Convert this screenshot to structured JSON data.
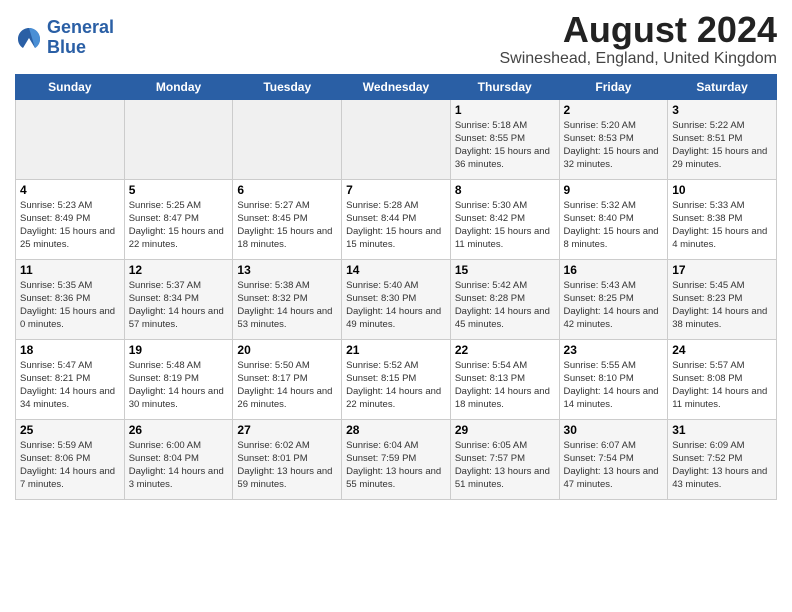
{
  "logo": {
    "name": "General",
    "name2": "Blue"
  },
  "title": "August 2024",
  "subtitle": "Swineshead, England, United Kingdom",
  "days_of_week": [
    "Sunday",
    "Monday",
    "Tuesday",
    "Wednesday",
    "Thursday",
    "Friday",
    "Saturday"
  ],
  "weeks": [
    [
      {
        "day": "",
        "sunrise": "",
        "sunset": "",
        "daylight": ""
      },
      {
        "day": "",
        "sunrise": "",
        "sunset": "",
        "daylight": ""
      },
      {
        "day": "",
        "sunrise": "",
        "sunset": "",
        "daylight": ""
      },
      {
        "day": "",
        "sunrise": "",
        "sunset": "",
        "daylight": ""
      },
      {
        "day": "1",
        "sunrise": "Sunrise: 5:18 AM",
        "sunset": "Sunset: 8:55 PM",
        "daylight": "Daylight: 15 hours and 36 minutes."
      },
      {
        "day": "2",
        "sunrise": "Sunrise: 5:20 AM",
        "sunset": "Sunset: 8:53 PM",
        "daylight": "Daylight: 15 hours and 32 minutes."
      },
      {
        "day": "3",
        "sunrise": "Sunrise: 5:22 AM",
        "sunset": "Sunset: 8:51 PM",
        "daylight": "Daylight: 15 hours and 29 minutes."
      }
    ],
    [
      {
        "day": "4",
        "sunrise": "Sunrise: 5:23 AM",
        "sunset": "Sunset: 8:49 PM",
        "daylight": "Daylight: 15 hours and 25 minutes."
      },
      {
        "day": "5",
        "sunrise": "Sunrise: 5:25 AM",
        "sunset": "Sunset: 8:47 PM",
        "daylight": "Daylight: 15 hours and 22 minutes."
      },
      {
        "day": "6",
        "sunrise": "Sunrise: 5:27 AM",
        "sunset": "Sunset: 8:45 PM",
        "daylight": "Daylight: 15 hours and 18 minutes."
      },
      {
        "day": "7",
        "sunrise": "Sunrise: 5:28 AM",
        "sunset": "Sunset: 8:44 PM",
        "daylight": "Daylight: 15 hours and 15 minutes."
      },
      {
        "day": "8",
        "sunrise": "Sunrise: 5:30 AM",
        "sunset": "Sunset: 8:42 PM",
        "daylight": "Daylight: 15 hours and 11 minutes."
      },
      {
        "day": "9",
        "sunrise": "Sunrise: 5:32 AM",
        "sunset": "Sunset: 8:40 PM",
        "daylight": "Daylight: 15 hours and 8 minutes."
      },
      {
        "day": "10",
        "sunrise": "Sunrise: 5:33 AM",
        "sunset": "Sunset: 8:38 PM",
        "daylight": "Daylight: 15 hours and 4 minutes."
      }
    ],
    [
      {
        "day": "11",
        "sunrise": "Sunrise: 5:35 AM",
        "sunset": "Sunset: 8:36 PM",
        "daylight": "Daylight: 15 hours and 0 minutes."
      },
      {
        "day": "12",
        "sunrise": "Sunrise: 5:37 AM",
        "sunset": "Sunset: 8:34 PM",
        "daylight": "Daylight: 14 hours and 57 minutes."
      },
      {
        "day": "13",
        "sunrise": "Sunrise: 5:38 AM",
        "sunset": "Sunset: 8:32 PM",
        "daylight": "Daylight: 14 hours and 53 minutes."
      },
      {
        "day": "14",
        "sunrise": "Sunrise: 5:40 AM",
        "sunset": "Sunset: 8:30 PM",
        "daylight": "Daylight: 14 hours and 49 minutes."
      },
      {
        "day": "15",
        "sunrise": "Sunrise: 5:42 AM",
        "sunset": "Sunset: 8:28 PM",
        "daylight": "Daylight: 14 hours and 45 minutes."
      },
      {
        "day": "16",
        "sunrise": "Sunrise: 5:43 AM",
        "sunset": "Sunset: 8:25 PM",
        "daylight": "Daylight: 14 hours and 42 minutes."
      },
      {
        "day": "17",
        "sunrise": "Sunrise: 5:45 AM",
        "sunset": "Sunset: 8:23 PM",
        "daylight": "Daylight: 14 hours and 38 minutes."
      }
    ],
    [
      {
        "day": "18",
        "sunrise": "Sunrise: 5:47 AM",
        "sunset": "Sunset: 8:21 PM",
        "daylight": "Daylight: 14 hours and 34 minutes."
      },
      {
        "day": "19",
        "sunrise": "Sunrise: 5:48 AM",
        "sunset": "Sunset: 8:19 PM",
        "daylight": "Daylight: 14 hours and 30 minutes."
      },
      {
        "day": "20",
        "sunrise": "Sunrise: 5:50 AM",
        "sunset": "Sunset: 8:17 PM",
        "daylight": "Daylight: 14 hours and 26 minutes."
      },
      {
        "day": "21",
        "sunrise": "Sunrise: 5:52 AM",
        "sunset": "Sunset: 8:15 PM",
        "daylight": "Daylight: 14 hours and 22 minutes."
      },
      {
        "day": "22",
        "sunrise": "Sunrise: 5:54 AM",
        "sunset": "Sunset: 8:13 PM",
        "daylight": "Daylight: 14 hours and 18 minutes."
      },
      {
        "day": "23",
        "sunrise": "Sunrise: 5:55 AM",
        "sunset": "Sunset: 8:10 PM",
        "daylight": "Daylight: 14 hours and 14 minutes."
      },
      {
        "day": "24",
        "sunrise": "Sunrise: 5:57 AM",
        "sunset": "Sunset: 8:08 PM",
        "daylight": "Daylight: 14 hours and 11 minutes."
      }
    ],
    [
      {
        "day": "25",
        "sunrise": "Sunrise: 5:59 AM",
        "sunset": "Sunset: 8:06 PM",
        "daylight": "Daylight: 14 hours and 7 minutes."
      },
      {
        "day": "26",
        "sunrise": "Sunrise: 6:00 AM",
        "sunset": "Sunset: 8:04 PM",
        "daylight": "Daylight: 14 hours and 3 minutes."
      },
      {
        "day": "27",
        "sunrise": "Sunrise: 6:02 AM",
        "sunset": "Sunset: 8:01 PM",
        "daylight": "Daylight: 13 hours and 59 minutes."
      },
      {
        "day": "28",
        "sunrise": "Sunrise: 6:04 AM",
        "sunset": "Sunset: 7:59 PM",
        "daylight": "Daylight: 13 hours and 55 minutes."
      },
      {
        "day": "29",
        "sunrise": "Sunrise: 6:05 AM",
        "sunset": "Sunset: 7:57 PM",
        "daylight": "Daylight: 13 hours and 51 minutes."
      },
      {
        "day": "30",
        "sunrise": "Sunrise: 6:07 AM",
        "sunset": "Sunset: 7:54 PM",
        "daylight": "Daylight: 13 hours and 47 minutes."
      },
      {
        "day": "31",
        "sunrise": "Sunrise: 6:09 AM",
        "sunset": "Sunset: 7:52 PM",
        "daylight": "Daylight: 13 hours and 43 minutes."
      }
    ]
  ]
}
